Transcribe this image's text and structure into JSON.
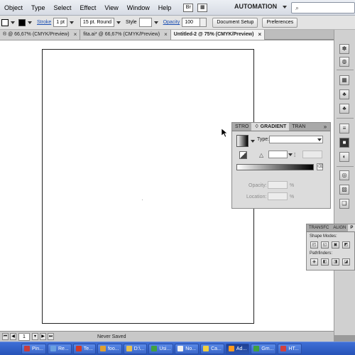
{
  "menubar": {
    "items": [
      "Object",
      "Type",
      "Select",
      "Effect",
      "View",
      "Window",
      "Help"
    ],
    "workspace": "AUTOMATION"
  },
  "controlbar": {
    "stroke_label": "Stroke",
    "stroke_value": "1 pt",
    "brush_value": "15 pt. Round",
    "style_label": "Style",
    "opacity_label": "Opacity",
    "opacity_value": "100",
    "document_setup": "Document Setup",
    "preferences": "Preferences"
  },
  "tabs": [
    {
      "label": "® @ 66,67% (CMYK/Preview)",
      "active": false
    },
    {
      "label": "fita.ai* @ 66,67% (CMYK/Preview)",
      "active": false
    },
    {
      "label": "Untitled-2 @ 75% (CMYK/Preview)",
      "active": true
    }
  ],
  "gradient_panel": {
    "tabs": [
      "STRO",
      "♢ GRADIENT",
      "TRAN"
    ],
    "type_label": "Type:",
    "opacity_label": "Opacity:",
    "location_label": "Location:",
    "percent": "%"
  },
  "pathfinder_panel": {
    "tabs": [
      "TRANSFC",
      "ALIGN",
      "P"
    ],
    "shape_modes_label": "Shape Modes:",
    "pathfinders_label": "Pathfinders:"
  },
  "statusbar": {
    "page_value": "1",
    "status_text": "Never Saved"
  },
  "taskbar": {
    "items": [
      {
        "label": "Pin...",
        "color": "#c83c3c",
        "active": false
      },
      {
        "label": "Re...",
        "color": "#6aa0e0",
        "active": false
      },
      {
        "label": "Te...",
        "color": "#d03a2a",
        "active": false
      },
      {
        "label": "foo...",
        "color": "#e0a030",
        "active": false
      },
      {
        "label": "D:\\...",
        "color": "#e6c050",
        "active": false
      },
      {
        "label": "Usi...",
        "color": "#40a040",
        "active": false
      },
      {
        "label": "No...",
        "color": "#f0f0f0",
        "active": false
      },
      {
        "label": "Ca...",
        "color": "#f0d040",
        "active": false
      },
      {
        "label": "Ad...",
        "color": "#ff9a1f",
        "active": true
      },
      {
        "label": "Gm...",
        "color": "#40a040",
        "active": false
      },
      {
        "label": "HT...",
        "color": "#d04040",
        "active": false
      }
    ]
  }
}
